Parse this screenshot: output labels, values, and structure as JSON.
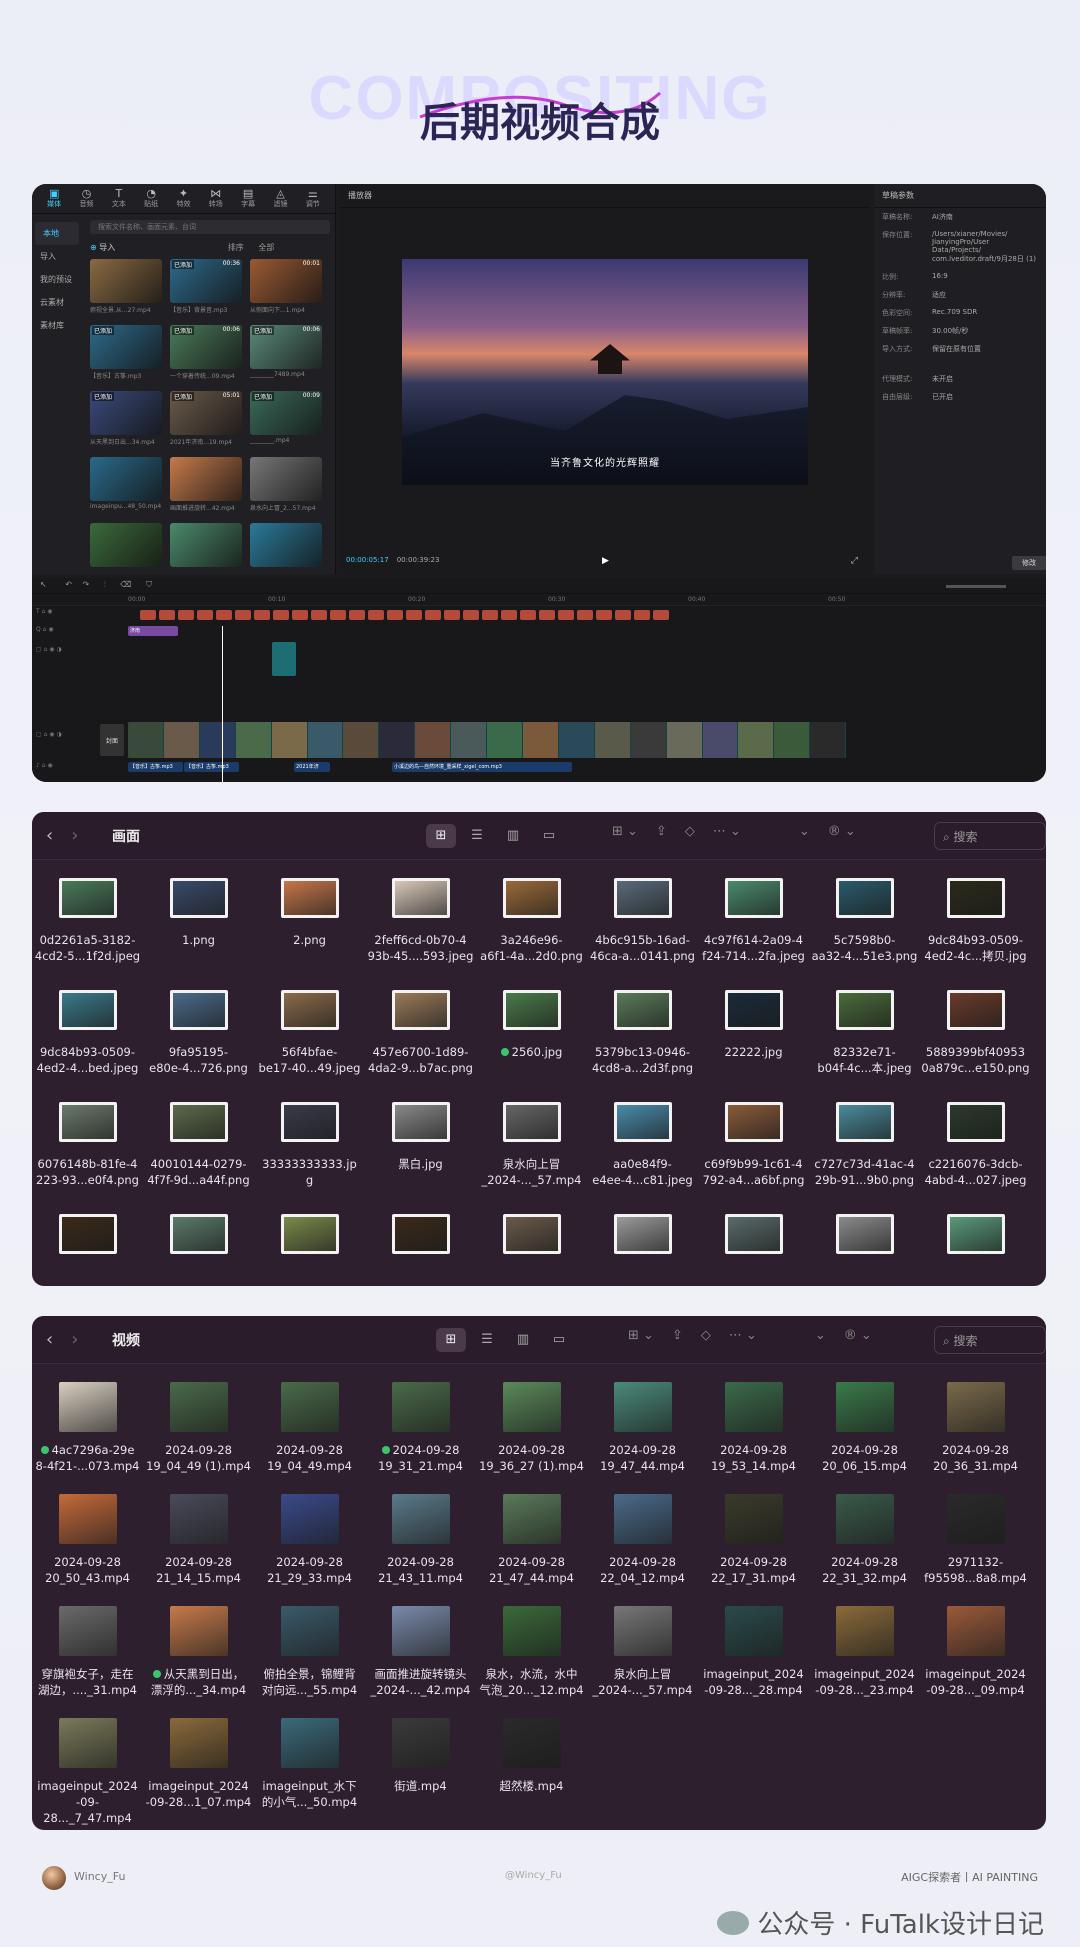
{
  "header": {
    "bg_text": "COMPOSITING",
    "title": "后期视频合成"
  },
  "editor": {
    "toolbar": [
      {
        "icon": "media-icon",
        "label": "媒体"
      },
      {
        "icon": "audio-icon",
        "label": "音频"
      },
      {
        "icon": "text-icon",
        "label": "文本"
      },
      {
        "icon": "sticker-icon",
        "label": "贴纸"
      },
      {
        "icon": "effect-icon",
        "label": "特效"
      },
      {
        "icon": "transition-icon",
        "label": "转场"
      },
      {
        "icon": "caption-icon",
        "label": "字幕"
      },
      {
        "icon": "filter-icon",
        "label": "滤镜"
      },
      {
        "icon": "adjust-icon",
        "label": "调节"
      }
    ],
    "side": [
      "本地",
      "导入",
      "我的预设",
      "云素材",
      "素材库"
    ],
    "search_placeholder": "搜索文件名称、画面元素、台词",
    "import_label": "导入",
    "all_label": "全部",
    "sort_label": "排序",
    "media": [
      {
        "name": "俯视全景,从...27.mp4",
        "dur": "",
        "added": "",
        "c": "#8a6a42"
      },
      {
        "name": "【音乐】背景音.mp3",
        "dur": "00:36",
        "added": "已添加",
        "c": "#2d6a8a"
      },
      {
        "name": "从侧面向下...1.mp4",
        "dur": "00:01",
        "added": "",
        "c": "#9a5a34"
      },
      {
        "name": "【音乐】古筝.mp3",
        "dur": "",
        "added": "已添加",
        "c": "#2d6a8a"
      },
      {
        "name": "一个穿着传统...09.mp4",
        "dur": "00:06",
        "added": "已添加",
        "c": "#4a7a5a"
      },
      {
        "name": "________7489.mp4",
        "dur": "00:06",
        "added": "已添加",
        "c": "#5a8a7a"
      },
      {
        "name": "从天黑到日出...34.mp4",
        "dur": "",
        "added": "已添加",
        "c": "#3a4a7a"
      },
      {
        "name": "2021年济南...19.mp4",
        "dur": "05:01",
        "added": "已添加",
        "c": "#6a5a4a"
      },
      {
        "name": "________.mp4",
        "dur": "00:09",
        "added": "已添加",
        "c": "#3a6a5a"
      },
      {
        "name": "imageinpu...48_50.mp4",
        "dur": "",
        "added": "",
        "c": "#2a6a8a"
      },
      {
        "name": "画面推进旋转...42.mp4",
        "dur": "",
        "added": "",
        "c": "#c67a4a"
      },
      {
        "name": "泉水向上冒_2...57.mp4",
        "dur": "",
        "added": "",
        "c": "#777"
      },
      {
        "name": "",
        "dur": "",
        "added": "",
        "c": "#3a6a3a"
      },
      {
        "name": "",
        "dur": "",
        "added": "",
        "c": "#4a8a6a"
      },
      {
        "name": "",
        "dur": "",
        "added": "",
        "c": "#2a7a9a"
      }
    ],
    "player_label": "播放器",
    "caption": "当齐鲁文化的光辉照耀",
    "timecode": "00:00:05:17",
    "duration": "00:00:39:23",
    "props_label": "草稿参数",
    "props": [
      {
        "k": "草稿名称:",
        "v": "AI济南"
      },
      {
        "k": "保存位置:",
        "v": "/Users/xianer/Movies/\nJianyingPro/User Data/Projects/\ncom.lveditor.draft/9月28日 (1)"
      },
      {
        "k": "比例:",
        "v": "16:9"
      },
      {
        "k": "分辨率:",
        "v": "适应"
      },
      {
        "k": "色彩空间:",
        "v": "Rec.709 SDR"
      },
      {
        "k": "草稿帧率:",
        "v": "30.00帧/秒"
      },
      {
        "k": "导入方式:",
        "v": "保留在原有位置"
      },
      {
        "k": "代理模式:",
        "v": "未开启"
      },
      {
        "k": "自由层级:",
        "v": "已开启"
      }
    ],
    "modify_label": "修改",
    "ruler": [
      "00:00",
      "00:10",
      "00:20",
      "00:30",
      "00:40",
      "00:50"
    ],
    "cover_label": "封面",
    "audio_clips": [
      "【音乐】古筝.mp3",
      "【音乐】古筝.mp3",
      "2021年济",
      "小溪边的鸟—自然环境_重采样_xigel_com.mp3"
    ],
    "text_clip": "济南"
  },
  "finder1": {
    "title": "画面",
    "search": "搜索",
    "items": [
      {
        "n": "0d2261a5-3182-\n4cd2-5...1f2d.jpeg",
        "c": "#4a7a5a",
        "w": 58
      },
      {
        "n": "1.png",
        "c": "#3a4a6a",
        "w": 58
      },
      {
        "n": "2.png",
        "c": "#c6764a",
        "w": 58
      },
      {
        "n": "2feff6cd-0b70-4\n93b-45....593.jpeg",
        "c": "#d8c8b8",
        "w": 58
      },
      {
        "n": "3a246e96-\na6f1-4a...2d0.png",
        "c": "#9a6a3a",
        "w": 58
      },
      {
        "n": "4b6c915b-16ad-\n46ca-a...0141.png",
        "c": "#5a6a7a",
        "w": 58
      },
      {
        "n": "4c97f614-2a09-4\nf24-714...2fa.jpeg",
        "c": "#4a8a6a",
        "w": 58
      },
      {
        "n": "5c7598b0-\naa32-4...51e3.png",
        "c": "#2a5a6a",
        "w": 58
      },
      {
        "n": "9dc84b93-0509-\n4ed2-4c...拷贝.jpg",
        "c": "#2a2a1a",
        "w": 58
      },
      {
        "n": "9dc84b93-0509-\n4ed2-4...bed.jpeg",
        "c": "#3a7a8a",
        "w": 58
      },
      {
        "n": "9fa95195-\ne80e-4...726.png",
        "c": "#4a6a8a",
        "w": 58
      },
      {
        "n": "56f4bfae-\nbe17-40...49.jpeg",
        "c": "#8a6a4a",
        "w": 58
      },
      {
        "n": "457e6700-1d89-\n4da2-9...b7ac.png",
        "c": "#9a7a5a",
        "w": 58
      },
      {
        "n": "2560.jpg",
        "c": "#4a7a4a",
        "w": 58,
        "dot": true
      },
      {
        "n": "5379bc13-0946-\n4cd8-a...2d3f.png",
        "c": "#5a7a5a",
        "w": 58
      },
      {
        "n": "22222.jpg",
        "c": "#1a2a3a",
        "w": 58
      },
      {
        "n": "82332e71-\nb04f-4c...本.jpeg",
        "c": "#4a6a3a",
        "w": 58
      },
      {
        "n": "5889399bf40953\n0a879c...e150.png",
        "c": "#6a3a2a",
        "w": 58
      },
      {
        "n": "6076148b-81fe-4\n223-93...e0f4.png",
        "c": "#6a7a6a",
        "w": 58
      },
      {
        "n": "40010144-0279-\n4f7f-9d...a44f.png",
        "c": "#5a6a4a",
        "w": 58
      },
      {
        "n": "33333333333.jp\ng",
        "c": "#3a3a4a",
        "w": 58
      },
      {
        "n": "黑白.jpg",
        "c": "#888",
        "w": 58
      },
      {
        "n": "泉水向上冒\n_2024-..._57.mp4",
        "c": "#666",
        "w": 58
      },
      {
        "n": "aa0e84f9-\ne4ee-4...c81.jpeg",
        "c": "#4a8aaa",
        "w": 58
      },
      {
        "n": "c69f9b99-1c61-4\n792-a4...a6bf.png",
        "c": "#8a5a3a",
        "w": 58
      },
      {
        "n": "c727c73d-41ac-4\n29b-91...9b0.png",
        "c": "#4a8a9a",
        "w": 58
      },
      {
        "n": "c2216076-3dcb-\n4abd-4...027.jpeg",
        "c": "#2a3a2a",
        "w": 58
      },
      {
        "n": "",
        "c": "#3a2a1a",
        "w": 58
      },
      {
        "n": "",
        "c": "#5a7a6a",
        "w": 58
      },
      {
        "n": "",
        "c": "#7a8a4a",
        "w": 58
      },
      {
        "n": "",
        "c": "#3a2a1a",
        "w": 58
      },
      {
        "n": "",
        "c": "#6a5a4a",
        "w": 58
      },
      {
        "n": "",
        "c": "#9a9a9a",
        "w": 58
      },
      {
        "n": "",
        "c": "#5a6a6a",
        "w": 58
      },
      {
        "n": "",
        "c": "#8a8a8a",
        "w": 58
      },
      {
        "n": "",
        "c": "#5a9a7a",
        "w": 58
      }
    ]
  },
  "finder2": {
    "title": "视频",
    "search": "搜索",
    "items": [
      {
        "n": "4ac7296a-29e\n8-4f21-...073.mp4",
        "c": "#d8cfc0",
        "dot": true
      },
      {
        "n": "2024-09-28\n19_04_49 (1).mp4",
        "c": "#4a6a4a"
      },
      {
        "n": "2024-09-28\n19_04_49.mp4",
        "c": "#4a6a4a"
      },
      {
        "n": "2024-09-28\n19_31_21.mp4",
        "c": "#4a6a4a",
        "dot": true
      },
      {
        "n": "2024-09-28\n19_36_27 (1).mp4",
        "c": "#5a8a5a"
      },
      {
        "n": "2024-09-28\n19_47_44.mp4",
        "c": "#4a8a7a"
      },
      {
        "n": "2024-09-28\n19_53_14.mp4",
        "c": "#3a6a4a"
      },
      {
        "n": "2024-09-28\n20_06_15.mp4",
        "c": "#3a7a4a"
      },
      {
        "n": "2024-09-28\n20_36_31.mp4",
        "c": "#7a6a4a"
      },
      {
        "n": "2024-09-28\n20_50_43.mp4",
        "c": "#c66a3a"
      },
      {
        "n": "2024-09-28\n21_14_15.mp4",
        "c": "#4a4a5a"
      },
      {
        "n": "2024-09-28\n21_29_33.mp4",
        "c": "#3a4a8a"
      },
      {
        "n": "2024-09-28\n21_43_11.mp4",
        "c": "#5a7a8a"
      },
      {
        "n": "2024-09-28\n21_47_44.mp4",
        "c": "#5a7a5a"
      },
      {
        "n": "2024-09-28\n22_04_12.mp4",
        "c": "#4a6a8a"
      },
      {
        "n": "2024-09-28\n22_17_31.mp4",
        "c": "#3a3a2a"
      },
      {
        "n": "2024-09-28\n22_31_32.mp4",
        "c": "#3a5a4a"
      },
      {
        "n": "2971132-\nf95598...8a8.mp4",
        "c": "#2a2a2a"
      },
      {
        "n": "穿旗袍女子，走在\n湖边，...._31.mp4",
        "c": "#6a6a6a"
      },
      {
        "n": "从天黑到日出，\n漂浮的..._34.mp4",
        "c": "#c67a4a",
        "dot": true
      },
      {
        "n": "俯拍全景，锦鲤背\n对向远..._55.mp4",
        "c": "#3a5a6a"
      },
      {
        "n": "画面推进旋转镜头\n_2024-..._42.mp4",
        "c": "#7a8aaa"
      },
      {
        "n": "泉水，水流，水中\n气泡_20..._12.mp4",
        "c": "#3a6a3a"
      },
      {
        "n": "泉水向上冒\n_2024-..._57.mp4",
        "c": "#777"
      },
      {
        "n": "imageinput_2024\n-09-28..._28.mp4",
        "c": "#2a4a4a"
      },
      {
        "n": "imageinput_2024\n-09-28..._23.mp4",
        "c": "#8a6a3a"
      },
      {
        "n": "imageinput_2024\n-09-28..._09.mp4",
        "c": "#9a5a3a"
      },
      {
        "n": "imageinput_2024\n-09-28..._7_47.mp4",
        "c": "#7a7a5a"
      },
      {
        "n": "imageinput_2024\n-09-28...1_07.mp4",
        "c": "#8a6a3a"
      },
      {
        "n": "imageinput_水下\n的小气..._50.mp4",
        "c": "#3a6a7a"
      },
      {
        "n": "街道.mp4",
        "c": "#3a3a3a"
      },
      {
        "n": "超然楼.mp4",
        "c": "#2a2a2a"
      }
    ]
  },
  "footer": {
    "author": "Wincy_Fu",
    "handle": "@Wincy_Fu",
    "tag": "AIGC探索者丨AI PAINTING",
    "watermark": "公众号 · FuTalk设计日记"
  }
}
